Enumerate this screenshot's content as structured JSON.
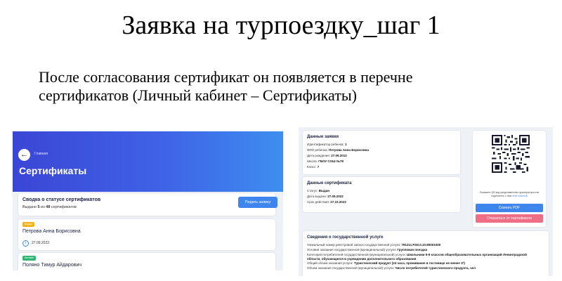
{
  "slide": {
    "title": "Заявка на турпоездку_шаг 1",
    "body": "После согласования сертификат он появляется в перечне сертификатов (Личный кабинет – Сертификаты)"
  },
  "left_panel": {
    "breadcrumb": "Главная",
    "page_title": "Сертификаты",
    "summary": {
      "title": "Сводка о статусе сертификатов",
      "prefix": "Выдано",
      "issued": "5",
      "of": "из",
      "total": "48",
      "suffix": "сертификатов",
      "button": "Подать заявку"
    },
    "items": [
      {
        "badge": "Выдан",
        "name": "Петрова Анна Борисовна",
        "date": "27.09.2022",
        "badge_color": "#f3b21b"
      },
      {
        "badge": "Активен",
        "name": "Поляно Тимур Айдарович",
        "badge_color": "#2fb574"
      }
    ],
    "header_gradient": [
      "#3b46d6",
      "#3e8ef0"
    ]
  },
  "right_panel": {
    "request": {
      "title": "Данные заявки",
      "rows": [
        {
          "label": "Идентификатор ребенка:",
          "value": "1"
        },
        {
          "label": "ФИО ребенка:",
          "value": "Петрова Анна Борисовна"
        },
        {
          "label": "Дата рождения:",
          "value": "27.09.2012"
        },
        {
          "label": "Школа:",
          "value": "ГБОУ СОШ №78"
        },
        {
          "label": "Класс:",
          "value": "7"
        }
      ]
    },
    "certificate": {
      "title": "Данные сертификата",
      "rows": [
        {
          "label": "Статус:",
          "value": "Выдан"
        },
        {
          "label": "Дата выдачи:",
          "value": "27.09.2022"
        },
        {
          "label": "Срок действия:",
          "value": "27.10.2022"
        }
      ]
    },
    "qr": {
      "note_main": "Покажите QR-код представителю туроператора или поделитесь с ним",
      "note_link": "этой ссылкой",
      "pdf_button": "Скачать PDF",
      "refuse_button": "Отказаться от сертификата"
    },
    "service": {
      "title": "Сведения о государственной услуге",
      "rows": [
        {
          "label": "Уникальный номер реестровой записи государственной услуги:",
          "value": "791211.Р.50.0.10.80001000"
        },
        {
          "label": "Условия оказания государственной (муниципальной) услуги:",
          "value": "Групповая поездка"
        },
        {
          "label": "Категория потребителей государственной (муниципальной) услуги:",
          "value": "Школьники 5-9 классов общеобразовательных организаций Ленинградской области, обучающиеся в учреждении дополнительного образования"
        },
        {
          "label": "Общий объем оказания услуги:",
          "value": "Туристический продукт (24 часа, проживание в гостинице не менее 3*)"
        },
        {
          "label": "Объем оказания государственной (муниципальной) услуги:",
          "value": "Число потребителей туристического продукта, чел"
        }
      ]
    }
  }
}
